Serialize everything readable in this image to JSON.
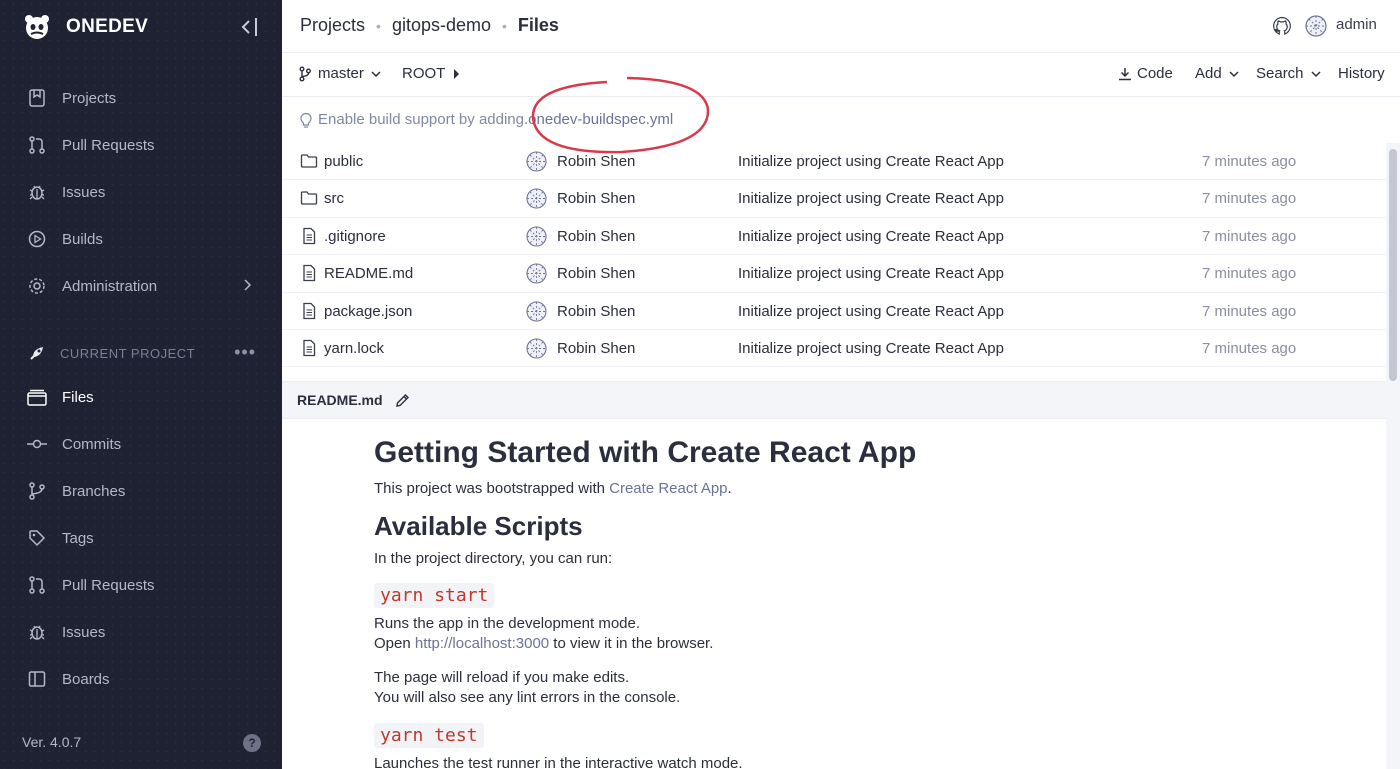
{
  "brand": {
    "name": "ONEDEV"
  },
  "sidebar": {
    "top_items": [
      {
        "label": "Projects",
        "icon": "projects-icon"
      },
      {
        "label": "Pull Requests",
        "icon": "pull-request-icon"
      },
      {
        "label": "Issues",
        "icon": "bug-icon"
      },
      {
        "label": "Builds",
        "icon": "play-circle-icon"
      },
      {
        "label": "Administration",
        "icon": "gear-icon"
      }
    ],
    "section_label": "CURRENT PROJECT",
    "section_more": "•••",
    "project_items": [
      {
        "label": "Files",
        "icon": "files-icon"
      },
      {
        "label": "Commits",
        "icon": "commit-icon"
      },
      {
        "label": "Branches",
        "icon": "branch-icon"
      },
      {
        "label": "Tags",
        "icon": "tag-icon"
      },
      {
        "label": "Pull Requests",
        "icon": "pull-request-icon"
      },
      {
        "label": "Issues",
        "icon": "bug-icon"
      },
      {
        "label": "Boards",
        "icon": "board-icon"
      }
    ],
    "version": "Ver. 4.0.7",
    "help": "?"
  },
  "header": {
    "breadcrumbs": [
      "Projects",
      "gitops-demo",
      "Files"
    ],
    "user": "admin"
  },
  "toolbar": {
    "branch": "master",
    "path": "ROOT",
    "code": "Code",
    "add": "Add",
    "search": "Search",
    "history": "History"
  },
  "hint": {
    "text": "Enable build support by adding ",
    "link": ".onedev-buildspec.yml"
  },
  "files": [
    {
      "name": "public",
      "type": "folder",
      "author": "Robin Shen",
      "message": "Initialize project using Create React App",
      "age": "7 minutes ago"
    },
    {
      "name": "src",
      "type": "folder",
      "author": "Robin Shen",
      "message": "Initialize project using Create React App",
      "age": "7 minutes ago"
    },
    {
      "name": ".gitignore",
      "type": "file",
      "author": "Robin Shen",
      "message": "Initialize project using Create React App",
      "age": "7 minutes ago"
    },
    {
      "name": "README.md",
      "type": "file",
      "author": "Robin Shen",
      "message": "Initialize project using Create React App",
      "age": "7 minutes ago"
    },
    {
      "name": "package.json",
      "type": "file",
      "author": "Robin Shen",
      "message": "Initialize project using Create React App",
      "age": "7 minutes ago"
    },
    {
      "name": "yarn.lock",
      "type": "file",
      "author": "Robin Shen",
      "message": "Initialize project using Create React App",
      "age": "7 minutes ago"
    }
  ],
  "readme": {
    "filename": "README.md",
    "h1": "Getting Started with Create React App",
    "intro_pre": "This project was bootstrapped with ",
    "intro_link": "Create React App",
    "intro_post": ".",
    "h2": "Available Scripts",
    "run_text": "In the project directory, you can run:",
    "cmd1": "yarn start",
    "cmd1_line1": "Runs the app in the development mode.",
    "cmd1_line2_pre": "Open ",
    "cmd1_line2_link": "http://localhost:3000",
    "cmd1_line2_post": " to view it in the browser.",
    "reload_line1": "The page will reload if you make edits.",
    "reload_line2": "You will also see any lint errors in the console.",
    "cmd2": "yarn test",
    "cmd2_line1": "Launches the test runner in the interactive watch mode."
  },
  "colors": {
    "sidebar_bg": "#1f2233",
    "annotation": "#d9394a",
    "link": "#6b7397",
    "code": "#c0392b"
  }
}
